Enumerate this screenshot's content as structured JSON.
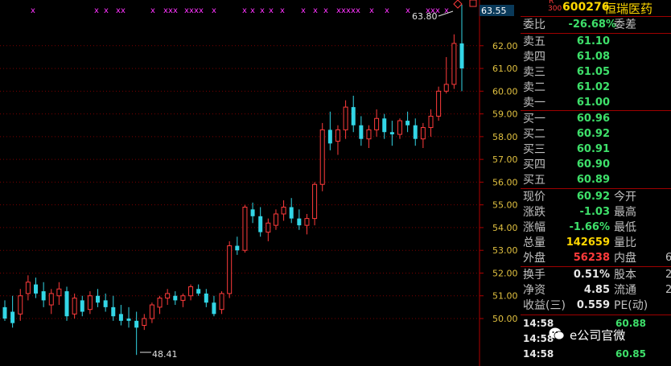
{
  "chart": {
    "y_ticks": [
      "63.55",
      "62.00",
      "61.00",
      "60.00",
      "59.00",
      "58.00",
      "57.00",
      "56.00",
      "55.00",
      "54.00",
      "53.00",
      "52.00",
      "51.00",
      "50.00"
    ],
    "high_label": "63.80",
    "low_label": "48.41",
    "current_price_tag": "63.55",
    "marker": "x",
    "colors": {
      "up": "#ff3b3b",
      "down": "#33d6e6",
      "grid": "#7a0000",
      "axis_text": "#e0c040",
      "marker": "#ff33ff"
    }
  },
  "chart_data": {
    "type": "candlestick",
    "ylim": [
      49.6,
      64.0
    ],
    "candles": [
      {
        "o": 50.5,
        "h": 50.8,
        "l": 49.9,
        "c": 50.0
      },
      {
        "o": 50.3,
        "h": 51.0,
        "l": 49.6,
        "c": 49.8
      },
      {
        "o": 50.2,
        "h": 51.3,
        "l": 49.9,
        "c": 51.0
      },
      {
        "o": 51.1,
        "h": 51.9,
        "l": 50.8,
        "c": 51.6
      },
      {
        "o": 51.5,
        "h": 51.8,
        "l": 50.9,
        "c": 51.1
      },
      {
        "o": 51.2,
        "h": 51.6,
        "l": 50.5,
        "c": 50.8
      },
      {
        "o": 50.6,
        "h": 51.3,
        "l": 50.2,
        "c": 51.1
      },
      {
        "o": 51.0,
        "h": 51.6,
        "l": 50.6,
        "c": 51.3
      },
      {
        "o": 51.2,
        "h": 51.4,
        "l": 49.9,
        "c": 50.1
      },
      {
        "o": 50.2,
        "h": 51.1,
        "l": 50.0,
        "c": 50.9
      },
      {
        "o": 50.8,
        "h": 51.0,
        "l": 50.1,
        "c": 50.3
      },
      {
        "o": 50.4,
        "h": 51.2,
        "l": 50.2,
        "c": 51.0
      },
      {
        "o": 51.0,
        "h": 51.3,
        "l": 50.5,
        "c": 50.7
      },
      {
        "o": 50.8,
        "h": 51.1,
        "l": 50.3,
        "c": 50.5
      },
      {
        "o": 50.5,
        "h": 51.0,
        "l": 49.9,
        "c": 50.1
      },
      {
        "o": 50.2,
        "h": 50.6,
        "l": 49.7,
        "c": 49.9
      },
      {
        "o": 50.0,
        "h": 50.5,
        "l": 49.6,
        "c": 49.9
      },
      {
        "o": 49.9,
        "h": 50.3,
        "l": 48.4,
        "c": 49.6
      },
      {
        "o": 49.7,
        "h": 50.2,
        "l": 49.5,
        "c": 50.0
      },
      {
        "o": 50.0,
        "h": 50.7,
        "l": 49.8,
        "c": 50.6
      },
      {
        "o": 50.5,
        "h": 51.0,
        "l": 50.2,
        "c": 50.9
      },
      {
        "o": 50.9,
        "h": 51.3,
        "l": 50.6,
        "c": 51.1
      },
      {
        "o": 51.0,
        "h": 51.2,
        "l": 50.6,
        "c": 50.8
      },
      {
        "o": 50.8,
        "h": 51.1,
        "l": 50.5,
        "c": 51.0
      },
      {
        "o": 51.0,
        "h": 51.5,
        "l": 50.8,
        "c": 51.4
      },
      {
        "o": 51.3,
        "h": 51.5,
        "l": 51.0,
        "c": 51.1
      },
      {
        "o": 51.1,
        "h": 51.3,
        "l": 50.5,
        "c": 50.7
      },
      {
        "o": 50.7,
        "h": 51.0,
        "l": 50.1,
        "c": 50.2
      },
      {
        "o": 50.4,
        "h": 51.2,
        "l": 50.2,
        "c": 51.1
      },
      {
        "o": 51.1,
        "h": 53.4,
        "l": 50.9,
        "c": 53.2
      },
      {
        "o": 53.2,
        "h": 53.6,
        "l": 52.8,
        "c": 53.0
      },
      {
        "o": 53.0,
        "h": 55.0,
        "l": 52.9,
        "c": 54.9
      },
      {
        "o": 54.8,
        "h": 55.1,
        "l": 54.2,
        "c": 54.5
      },
      {
        "o": 54.5,
        "h": 54.9,
        "l": 53.6,
        "c": 53.8
      },
      {
        "o": 53.8,
        "h": 54.4,
        "l": 53.4,
        "c": 54.2
      },
      {
        "o": 54.1,
        "h": 54.8,
        "l": 53.9,
        "c": 54.6
      },
      {
        "o": 54.6,
        "h": 55.2,
        "l": 54.3,
        "c": 54.9
      },
      {
        "o": 54.9,
        "h": 55.3,
        "l": 54.2,
        "c": 54.4
      },
      {
        "o": 54.4,
        "h": 54.8,
        "l": 53.9,
        "c": 54.1
      },
      {
        "o": 54.1,
        "h": 54.6,
        "l": 53.7,
        "c": 54.4
      },
      {
        "o": 54.4,
        "h": 56.0,
        "l": 54.1,
        "c": 55.9
      },
      {
        "o": 55.9,
        "h": 58.6,
        "l": 55.6,
        "c": 58.3
      },
      {
        "o": 58.3,
        "h": 59.1,
        "l": 57.4,
        "c": 57.7
      },
      {
        "o": 57.8,
        "h": 58.5,
        "l": 57.2,
        "c": 58.3
      },
      {
        "o": 58.3,
        "h": 59.6,
        "l": 57.9,
        "c": 59.3
      },
      {
        "o": 59.3,
        "h": 59.8,
        "l": 58.2,
        "c": 58.5
      },
      {
        "o": 58.5,
        "h": 58.9,
        "l": 57.6,
        "c": 57.9
      },
      {
        "o": 57.9,
        "h": 58.5,
        "l": 57.5,
        "c": 58.3
      },
      {
        "o": 58.3,
        "h": 59.2,
        "l": 58.0,
        "c": 58.8
      },
      {
        "o": 58.8,
        "h": 59.0,
        "l": 57.9,
        "c": 58.2
      },
      {
        "o": 58.2,
        "h": 58.7,
        "l": 57.6,
        "c": 58.1
      },
      {
        "o": 58.1,
        "h": 58.8,
        "l": 57.9,
        "c": 58.7
      },
      {
        "o": 58.7,
        "h": 59.1,
        "l": 58.2,
        "c": 58.5
      },
      {
        "o": 58.5,
        "h": 58.8,
        "l": 57.6,
        "c": 57.9
      },
      {
        "o": 57.9,
        "h": 58.6,
        "l": 57.5,
        "c": 58.4
      },
      {
        "o": 58.4,
        "h": 59.2,
        "l": 58.0,
        "c": 58.9
      },
      {
        "o": 58.9,
        "h": 60.2,
        "l": 58.7,
        "c": 60.0
      },
      {
        "o": 60.0,
        "h": 61.5,
        "l": 59.9,
        "c": 60.3
      },
      {
        "o": 60.3,
        "h": 62.5,
        "l": 60.1,
        "c": 62.1
      },
      {
        "o": 62.1,
        "h": 63.8,
        "l": 60.0,
        "c": 61.0
      }
    ]
  },
  "panel": {
    "header": {
      "flag": "R",
      "flag2": "300",
      "code": "600276",
      "name": "恒瑞医药"
    },
    "ratio": {
      "label": "委比",
      "value": "-26.68%",
      "label2": "委差"
    },
    "asks": [
      {
        "label": "卖五",
        "price": "61.10"
      },
      {
        "label": "卖四",
        "price": "61.08"
      },
      {
        "label": "卖三",
        "price": "61.05"
      },
      {
        "label": "卖二",
        "price": "61.02"
      },
      {
        "label": "卖一",
        "price": "61.00"
      }
    ],
    "bids": [
      {
        "label": "买一",
        "price": "60.96"
      },
      {
        "label": "买二",
        "price": "60.92"
      },
      {
        "label": "买三",
        "price": "60.91"
      },
      {
        "label": "买四",
        "price": "60.90"
      },
      {
        "label": "买五",
        "price": "60.89"
      }
    ],
    "quote": [
      {
        "label": "现价",
        "value": "60.92",
        "label2": "今开",
        "value2": ""
      },
      {
        "label": "涨跌",
        "value": "-1.03",
        "label2": "最高",
        "value2": ""
      },
      {
        "label": "涨幅",
        "value": "-1.66%",
        "label2": "最低",
        "value2": ""
      },
      {
        "label": "总量",
        "value": "142659",
        "label2": "量比",
        "value2": ""
      },
      {
        "label": "外盘",
        "value": "56238",
        "label2": "内盘",
        "value2": "6"
      }
    ],
    "stats": [
      {
        "label": "换手",
        "value": "0.51%",
        "label2": "股本",
        "value2": "2"
      },
      {
        "label": "净资",
        "value": "4.85",
        "label2": "流通",
        "value2": "2"
      },
      {
        "label": "收益(三)",
        "value": "0.559",
        "label2": "PE(动)",
        "value2": ""
      }
    ],
    "ticks": [
      {
        "time": "14:58",
        "price": "60.88"
      },
      {
        "time": "14:58",
        "price": ""
      },
      {
        "time": "14:58",
        "price": "60.85"
      }
    ],
    "watermark": "e公司官微"
  }
}
